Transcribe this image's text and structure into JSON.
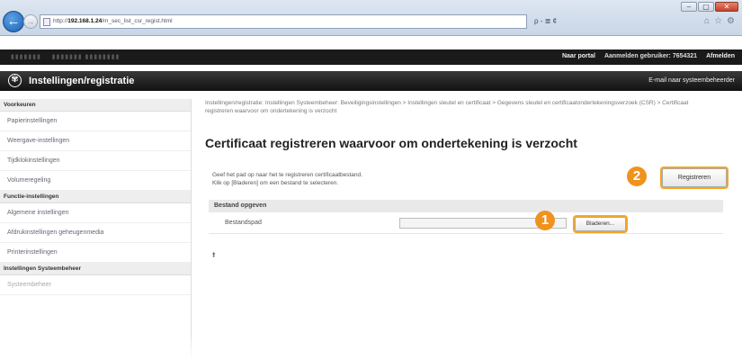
{
  "browser": {
    "address_prefix": "http://",
    "address_host": "192.168.1.24",
    "address_path": "/m_sec_list_csr_regist.html",
    "addr_tools": "ρ - ≣ ¢",
    "window_controls": [
      "–",
      "▢",
      "✕"
    ]
  },
  "topbar": {
    "portal_link": "Naar portal",
    "login_label": "Aanmelden gebruiker:",
    "user_id": "7654321",
    "logout_link": "Afmelden"
  },
  "titlebar": {
    "title": "Instellingen/registratie",
    "mail_link": "E-mail naar systeembeheerder"
  },
  "sidebar": {
    "sections": [
      {
        "heading": "Voorkeuren",
        "items": [
          "Papierinstellingen",
          "Weergave-instellingen",
          "Tijdklokinstellingen",
          "Volumeregeling"
        ]
      },
      {
        "heading": "Functie-instellingen",
        "items": [
          "Algemene instellingen",
          "Afdrukinstellingen geheugenmedia",
          "Printerinstellingen"
        ]
      },
      {
        "heading": "Instellingen Systeembeheer",
        "items": [
          "Systeembeheer"
        ]
      }
    ]
  },
  "main": {
    "breadcrumb": "Instellingen/registratie: Instellingen Systeembeheer: Beveiligingsinstellingen > Instellingen sleutel en certificaat > Gegevens sleutel en certificaatondertekeningsverzoek (CSR) > Certificaat registreren waarvoor om ondertekening is verzocht",
    "title": "Certificaat registreren waarvoor om ondertekening is verzocht",
    "instruction_line1": "Geef het pad op naar het te registreren certificaatbestand.",
    "instruction_line2": "Klik op [Bladeren] om een bestand te selecteren.",
    "register_button": "Registreren",
    "section_heading": "Bestand opgeven",
    "file_label": "Bestandspad",
    "file_value": "",
    "browse_button": "Bladeren...",
    "top_icon": "⯒"
  },
  "callouts": {
    "step1": "1",
    "step2": "2"
  }
}
